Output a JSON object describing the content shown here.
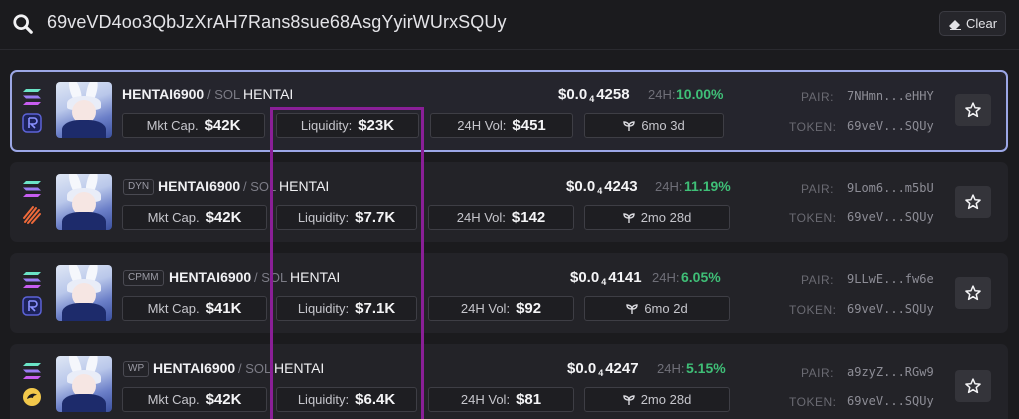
{
  "search": {
    "value": "69veVD4oo3QbJzXrAH7Rans8sue68AsgYyirWUrxSQUy",
    "clear_label": "Clear"
  },
  "labels": {
    "mkt_cap": "Mkt Cap.",
    "liquidity": "Liquidity:",
    "vol": "24H Vol:",
    "h24": "24H:",
    "pair": "PAIR:",
    "token": "TOKEN:"
  },
  "results": [
    {
      "tag": "",
      "symbol": "HENTAI6900",
      "quote": "/ SOL",
      "name": "HENTAI",
      "price_prefix": "$0.0",
      "price_zeros": "4",
      "price_digits": "4258",
      "change": "10.00%",
      "mkt_cap": "$42K",
      "liquidity": "$23K",
      "volume": "$451",
      "age": "6mo 3d",
      "pair": "7NHmn...eHHY",
      "token": "69veV...SQUy",
      "dex_icon": "raydium-icon"
    },
    {
      "tag": "DYN",
      "symbol": "HENTAI6900",
      "quote": "/ SOL",
      "name": "HENTAI",
      "price_prefix": "$0.0",
      "price_zeros": "4",
      "price_digits": "4243",
      "change": "11.19%",
      "mkt_cap": "$42K",
      "liquidity": "$7.7K",
      "volume": "$142",
      "age": "2mo 28d",
      "pair": "9Lom6...m5bU",
      "token": "69veV...SQUy",
      "dex_icon": "meteora-icon"
    },
    {
      "tag": "CPMM",
      "symbol": "HENTAI6900",
      "quote": "/ SOL",
      "name": "HENTAI",
      "price_prefix": "$0.0",
      "price_zeros": "4",
      "price_digits": "4141",
      "change": "6.05%",
      "mkt_cap": "$41K",
      "liquidity": "$7.1K",
      "volume": "$92",
      "age": "6mo 2d",
      "pair": "9LLwE...fw6e",
      "token": "69veV...SQUy",
      "dex_icon": "raydium-icon"
    },
    {
      "tag": "WP",
      "symbol": "HENTAI6900",
      "quote": "/ SOL",
      "name": "HENTAI",
      "price_prefix": "$0.0",
      "price_zeros": "4",
      "price_digits": "4247",
      "change": "5.15%",
      "mkt_cap": "$42K",
      "liquidity": "$6.4K",
      "volume": "$81",
      "age": "2mo 28d",
      "pair": "a9zyZ...RGw9",
      "token": "69veV...SQUy",
      "dex_icon": "orca-icon"
    }
  ],
  "colors": {
    "accent_selected": "#9ca7e6",
    "positive": "#3fbf77",
    "highlight": "#8a1f97"
  }
}
